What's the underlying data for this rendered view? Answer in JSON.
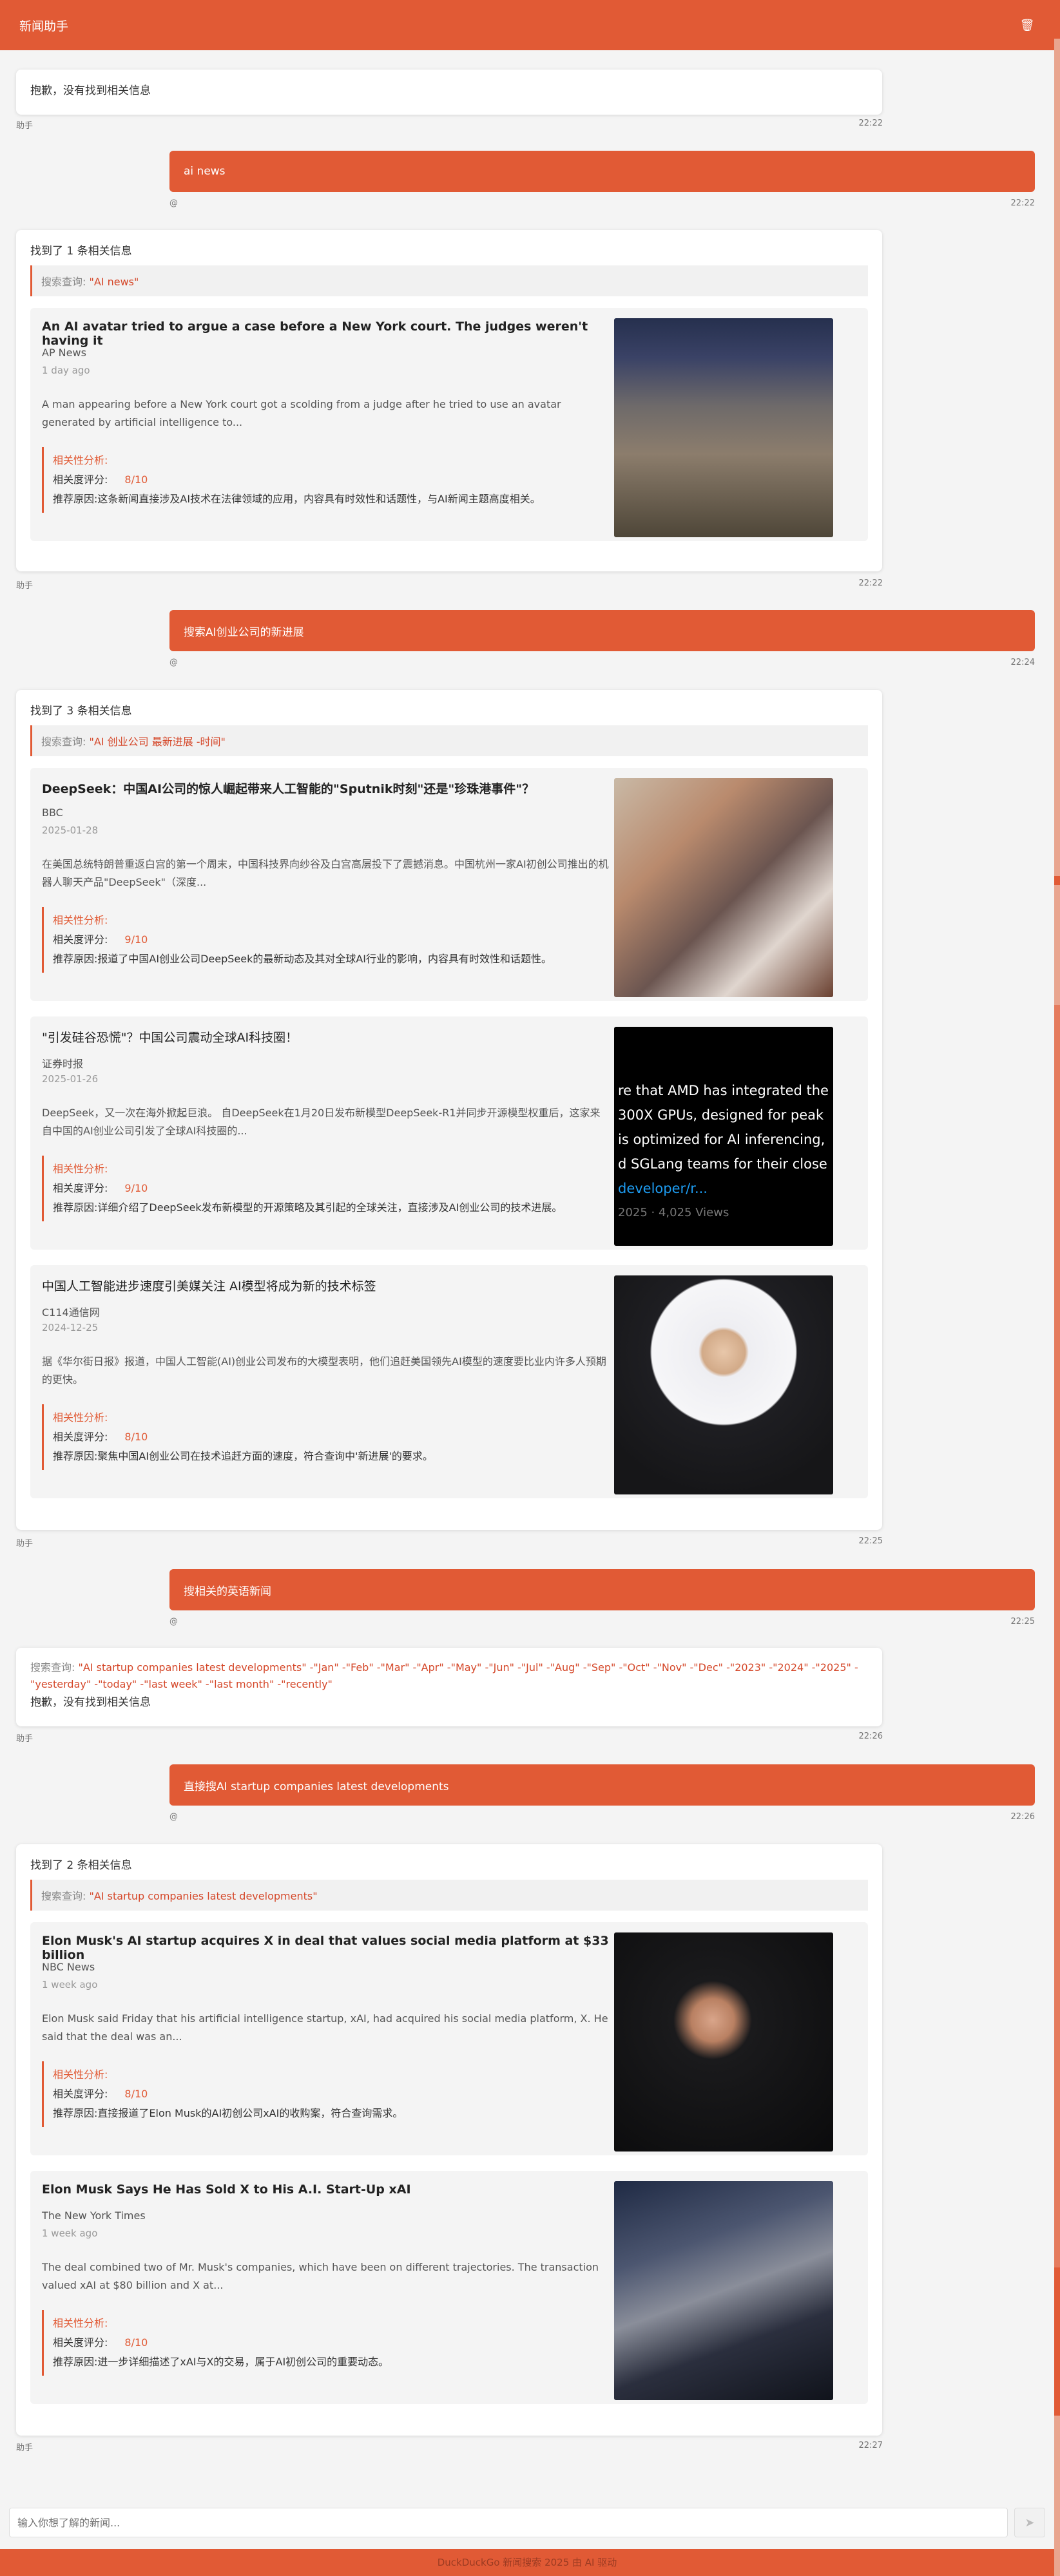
{
  "header": {
    "title": "新闻助手",
    "trash_icon": "trash-icon"
  },
  "theme": {
    "accent": "#e15a35",
    "accent_text": "#d5482a",
    "scroll_track": "#e9a58f"
  },
  "labels": {
    "assistant": "助手",
    "user": "@",
    "relevance_heading": "相关性分析:",
    "score_label": "相关度评分:",
    "reason_label": "推荐原因:",
    "query_label": "搜索查询:"
  },
  "messages": [
    {
      "role": "assistant",
      "text": "抱歉，没有找到相关信息",
      "time": "22:22"
    },
    {
      "role": "user",
      "text": "ai news",
      "time": "22:22"
    },
    {
      "role": "assistant",
      "time": "22:22",
      "found_text": "找到了 1 条相关信息",
      "query": "\"AI news\"",
      "results": [
        {
          "title": "An AI avatar tried to argue a case before a New York court. The judges weren't having it",
          "source": "AP News",
          "date": "1 day ago",
          "summary": "A man appearing before a New York court got a scolding from a judge after he tried to use an avatar generated by artificial intelligence to...",
          "score": "8/10",
          "reason": "这条新闻直接涉及AI技术在法律领域的应用，内容具有时效性和话题性，与AI新闻主题高度相关。",
          "image": "court-hearing-photo"
        }
      ]
    },
    {
      "role": "user",
      "text": "搜索AI创业公司的新进展",
      "time": "22:24"
    },
    {
      "role": "assistant",
      "time": "22:25",
      "found_text": "找到了 3 条相关信息",
      "query": "\"AI 创业公司 最新进展 -时间\"",
      "results": [
        {
          "title": "DeepSeek：中国AI公司的惊人崛起带来人工智能的\"Sputnik时刻\"还是\"珍珠港事件\"？",
          "source": "BBC",
          "date": "2025-01-28",
          "summary": "在美国总统特朗普重返白宫的第一个周末，中国科技界向纱谷及白宫高层投下了震撼消息。中国杭州一家AI初创公司推出的机器人聊天产品\"DeepSeek\"（深度...",
          "score": "9/10",
          "reason": "报道了中国AI创业公司DeepSeek的最新动态及其对全球AI行业的影响，内容具有时效性和话题性。",
          "image": "conference-photo"
        },
        {
          "title": "\"引发硅谷恐慌\"？中国公司震动全球AI科技圈！",
          "source": "证券时报",
          "date": "2025-01-26",
          "summary": "DeepSeek，又一次在海外掀起巨浪。 自DeepSeek在1月20日发布新模型DeepSeek-R1并同步开源模型权重后，这家来自中国的AI创业公司引发了全球AI科技圈的...",
          "score": "9/10",
          "reason": "详细介绍了DeepSeek发布新模型的开源策略及其引起的全球关注，直接涉及AI创业公司的技术进展。",
          "image": "tweet-screenshot",
          "image_lines": [
            "re that AMD has integrated the",
            "300X GPUs, designed for peak",
            "is optimized for AI inferencing,",
            "d SGLang teams for their close",
            "developer/r...",
            "2025 · 4,025 Views"
          ]
        },
        {
          "title": "中国人工智能进步速度引美媒关注 AI模型将成为新的技术标签",
          "source": "C114通信网",
          "date": "2024-12-25",
          "summary": "据《华尔街日报》报道，中国人工智能(AI)创业公司发布的大模型表明，他们追赶美国领先AI模型的速度要比业内许多人预期的更快。",
          "score": "8/10",
          "reason": "聚焦中国AI创业公司在技术追赶方面的速度，符合查询中'新进展'的要求。",
          "image": "speaker-photo"
        }
      ]
    },
    {
      "role": "user",
      "text": "搜相关的英语新闻",
      "time": "22:25"
    },
    {
      "role": "assistant",
      "time": "22:26",
      "query": "\"AI startup companies latest developments\" -\"Jan\" -\"Feb\" -\"Mar\" -\"Apr\" -\"May\" -\"Jun\" -\"Jul\" -\"Aug\" -\"Sep\" -\"Oct\" -\"Nov\" -\"Dec\" -\"2023\" -\"2024\" -\"2025\" -\"yesterday\" -\"today\" -\"last week\" -\"last month\" -\"recently\"",
      "text": "抱歉，没有找到相关信息"
    },
    {
      "role": "user",
      "text": "直接搜AI startup companies latest developments",
      "time": "22:26"
    },
    {
      "role": "assistant",
      "time": "22:27",
      "found_text": "找到了 2 条相关信息",
      "query": "\"AI startup companies latest developments\"",
      "results": [
        {
          "title": "Elon Musk's AI startup acquires X in deal that values social media platform at $33 billion",
          "source": "NBC News",
          "date": "1 week ago",
          "summary": "Elon Musk said Friday that his artificial intelligence startup, xAI, had acquired his social media platform, X. He said that the deal was an...",
          "score": "8/10",
          "reason": "直接报道了Elon Musk的AI初创公司xAI的收购案，符合查询需求。",
          "image": "speaker-portrait"
        },
        {
          "title": "Elon Musk Says He Has Sold X to His A.I. Start-Up xAI",
          "source": "The New York Times",
          "date": "1 week ago",
          "summary": "The deal combined two of Mr. Musk's companies, which have been on different trajectories. The transaction valued xAI at $80 billion and X at...",
          "score": "8/10",
          "reason": "进一步详细描述了xAI与X的交易，属于AI初创公司的重要动态。",
          "image": "arena-photo"
        }
      ]
    }
  ],
  "input": {
    "placeholder": "输入你想了解的新闻...",
    "send_icon": "send-icon"
  },
  "footer": {
    "text": "DuckDuckGo 新闻搜索 2025 由 AI 驱动"
  }
}
